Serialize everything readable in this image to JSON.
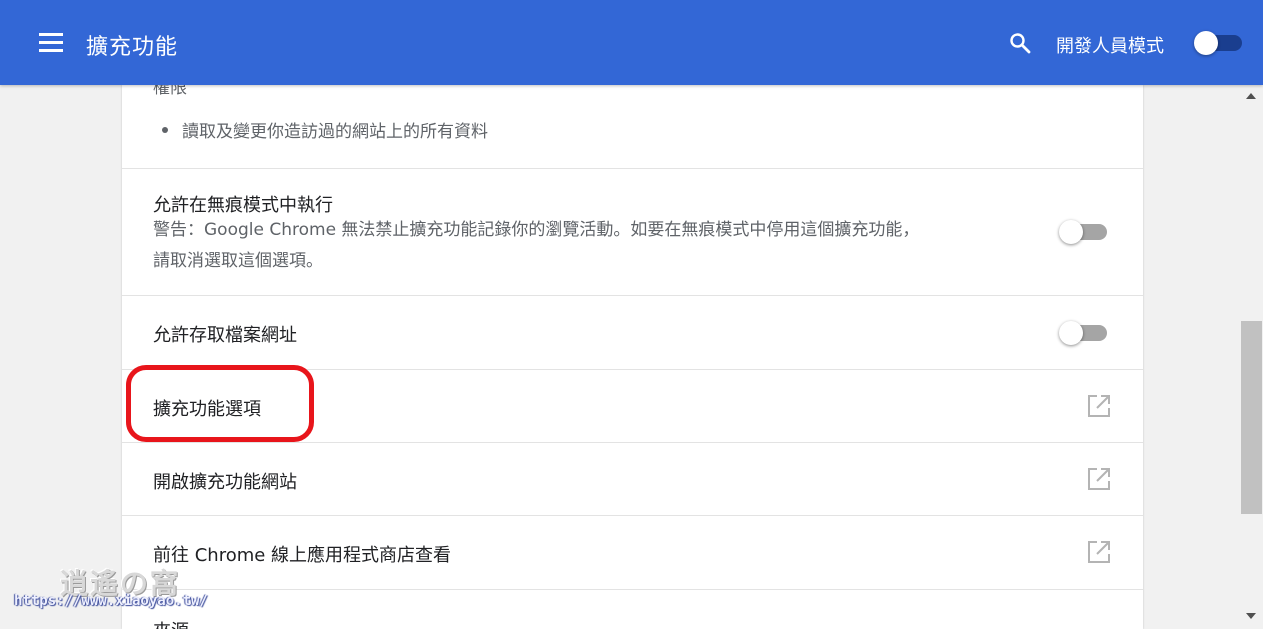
{
  "header": {
    "title": "擴充功能",
    "dev_mode_label": "開發人員模式",
    "dev_mode_on": true
  },
  "permissions": {
    "heading": "權限",
    "items": [
      "讀取及變更你造訪過的網站上的所有資料"
    ]
  },
  "settings": {
    "incognito": {
      "label": "允許在無痕模式中執行",
      "warning_line1": "警告：Google Chrome 無法禁止擴充功能記錄你的瀏覽活動。如要在無痕模式中停用這個擴充功能，",
      "warning_line2": "請取消選取這個選項。",
      "enabled": false
    },
    "file_urls": {
      "label": "允許存取檔案網址",
      "enabled": false
    }
  },
  "links": [
    {
      "label": "擴充功能選項",
      "icon": "open-in-new-icon"
    },
    {
      "label": "開啟擴充功能網站",
      "icon": "open-in-new-icon"
    },
    {
      "label": "前往 Chrome 線上應用程式商店查看",
      "icon": "open-in-new-icon"
    }
  ],
  "source": {
    "heading": "來源"
  },
  "watermark": {
    "logo": "逍遙の窩",
    "url": "https://www.xiaoyao.tw/"
  },
  "colors": {
    "header_bg": "#3367d6",
    "highlight": "#e8151b",
    "toggle_off_track": "#a5a5a5"
  }
}
